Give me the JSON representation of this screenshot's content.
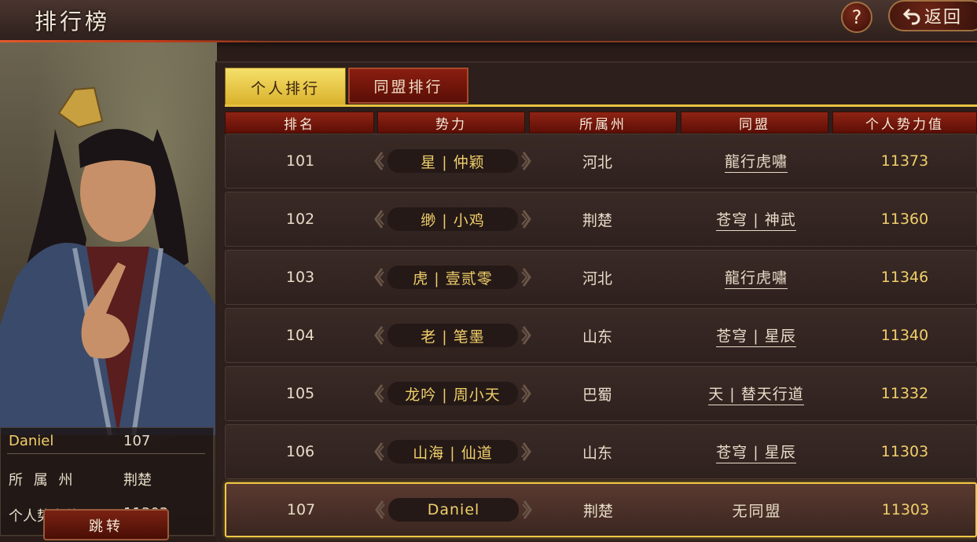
{
  "header": {
    "title": "排行榜",
    "help_label": "?",
    "back_label": "返回"
  },
  "player": {
    "name": "Daniel",
    "rank": "107",
    "state_label": "所 属 州",
    "state": "荆楚",
    "power_label": "个人势力值",
    "power": "11303",
    "jump_label": "跳转"
  },
  "tabs": [
    {
      "label": "个人排行",
      "active": true
    },
    {
      "label": "同盟排行",
      "active": false
    }
  ],
  "columns": [
    "排名",
    "势力",
    "所属州",
    "同盟",
    "个人势力值"
  ],
  "rows": [
    {
      "rank": "101",
      "force": "星 | 仲颖",
      "state": "河北",
      "alliance": "龍行虎嘯",
      "alliance_link": true,
      "power": "11373"
    },
    {
      "rank": "102",
      "force": "缈 | 小鸡",
      "state": "荆楚",
      "alliance": "苍穹 | 神武",
      "alliance_link": true,
      "power": "11360"
    },
    {
      "rank": "103",
      "force": "虎 | 壹贰零",
      "state": "河北",
      "alliance": "龍行虎嘯",
      "alliance_link": true,
      "power": "11346"
    },
    {
      "rank": "104",
      "force": "老 | 笔墨",
      "state": "山东",
      "alliance": "苍穹 | 星辰",
      "alliance_link": true,
      "power": "11340"
    },
    {
      "rank": "105",
      "force": "龙吟 | 周小天",
      "state": "巴蜀",
      "alliance": "天 | 替天行道",
      "alliance_link": true,
      "power": "11332"
    },
    {
      "rank": "106",
      "force": "山海 | 仙道",
      "state": "山东",
      "alliance": "苍穹 | 星辰",
      "alliance_link": true,
      "power": "11303"
    },
    {
      "rank": "107",
      "force": "Daniel",
      "state": "荆楚",
      "alliance": "无同盟",
      "alliance_link": false,
      "power": "11303",
      "is_player": true
    }
  ]
}
